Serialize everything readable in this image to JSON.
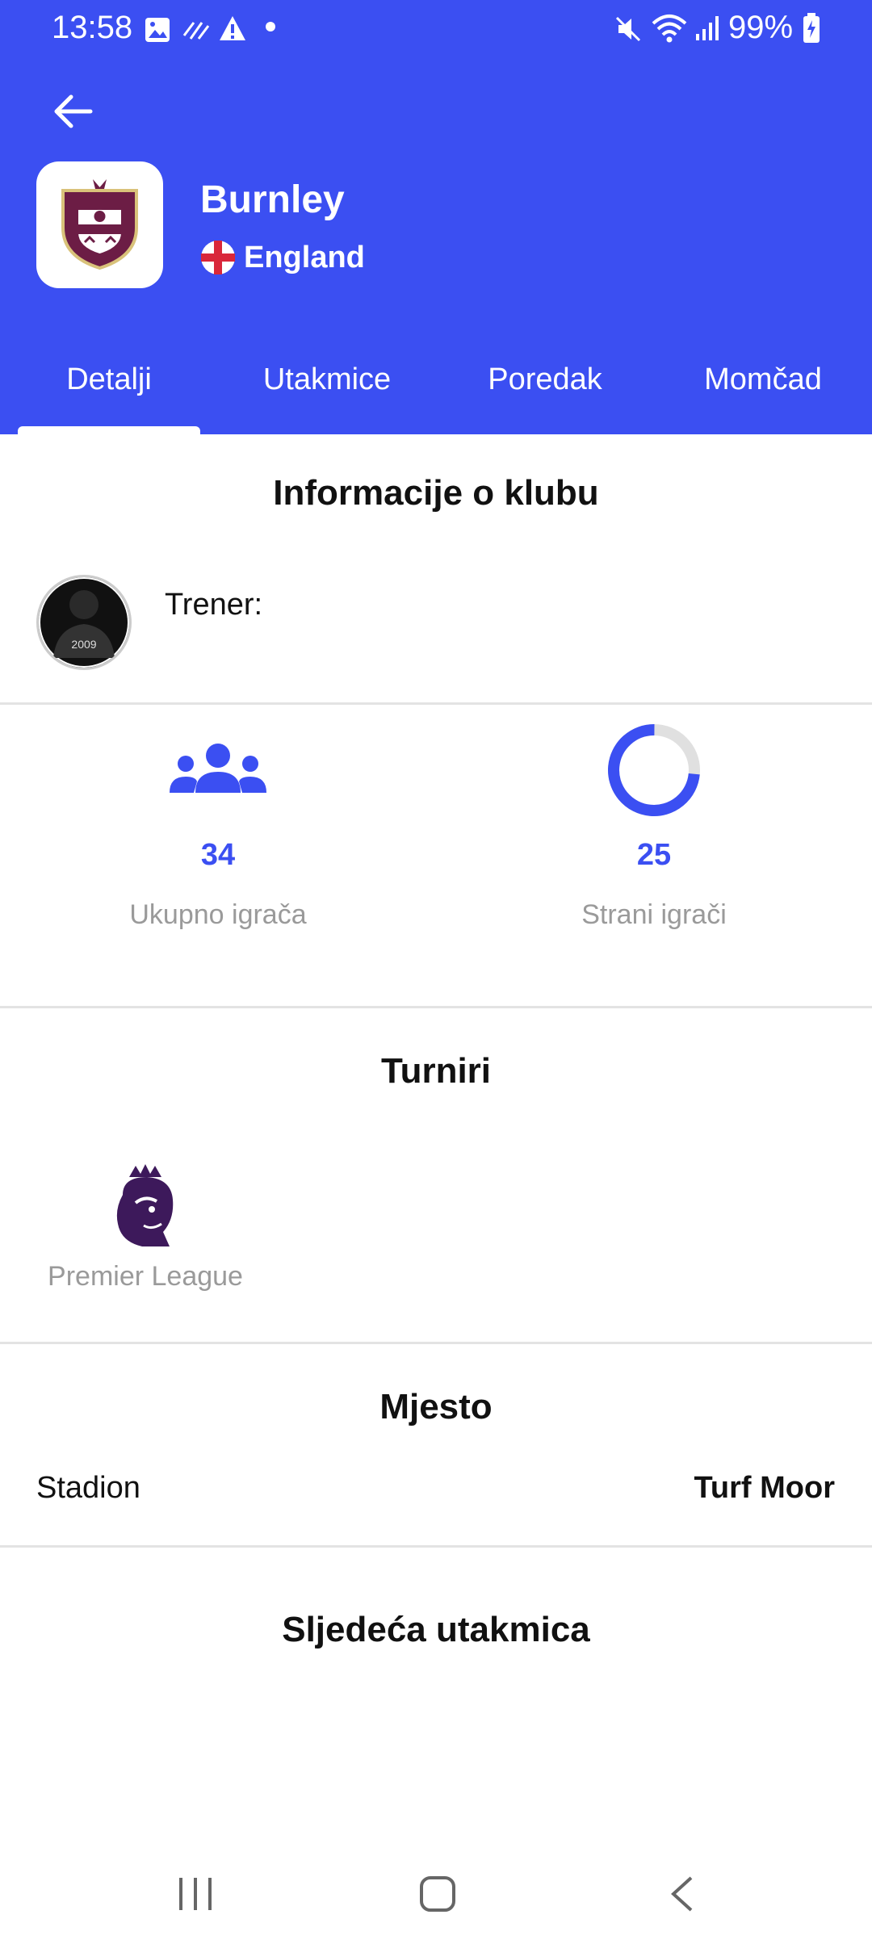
{
  "status_bar": {
    "time": "13:58",
    "battery": "99%",
    "icons_left": [
      "image-icon",
      "sync-icon",
      "warning-icon",
      "dot-icon"
    ],
    "icons_right": [
      "mute-icon",
      "wifi-icon",
      "signal-icon",
      "battery-charging-icon"
    ]
  },
  "header": {
    "club_name": "Burnley",
    "country": "England",
    "accent_color": "#3b4ff2"
  },
  "tabs": [
    {
      "label": "Detalji",
      "active": true
    },
    {
      "label": "Utakmice",
      "active": false
    },
    {
      "label": "Poredak",
      "active": false
    },
    {
      "label": "Momčad",
      "active": false
    }
  ],
  "club_info": {
    "title": "Informacije o klubu",
    "coach_label": "Trener:",
    "avatar_text": "2009"
  },
  "stats": {
    "total_players_value": "34",
    "total_players_label": "Ukupno igrača",
    "foreign_players_value": "25",
    "foreign_players_label": "Strani igrači",
    "foreign_ratio": 0.735
  },
  "tournaments": {
    "title": "Turniri",
    "items": [
      {
        "name": "Premier League"
      }
    ]
  },
  "place": {
    "title": "Mjesto",
    "stadium_label": "Stadion",
    "stadium_value": "Turf Moor"
  },
  "next_match": {
    "title": "Sljedeća utakmica"
  }
}
